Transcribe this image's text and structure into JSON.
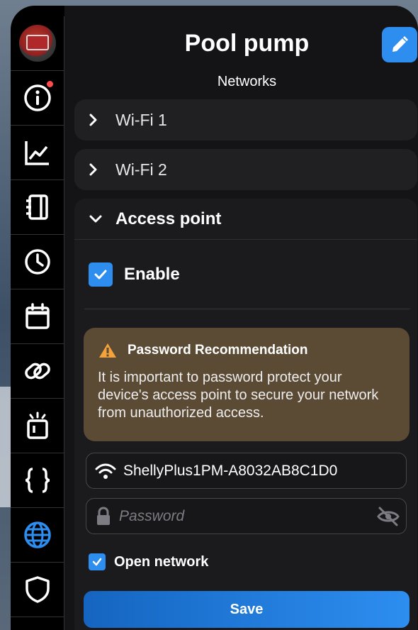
{
  "app": {
    "title": "Pool pump",
    "subtitle": "Networks",
    "accent_color": "#2d8ef0"
  },
  "sidebar": {
    "items": [
      {
        "name": "device-avatar",
        "icon": "device-avatar"
      },
      {
        "name": "info",
        "icon": "info-icon",
        "notification": true
      },
      {
        "name": "charts",
        "icon": "chart-icon"
      },
      {
        "name": "components",
        "icon": "components-icon"
      },
      {
        "name": "schedules",
        "icon": "clock-icon"
      },
      {
        "name": "calendar",
        "icon": "calendar-icon"
      },
      {
        "name": "links",
        "icon": "link-icon"
      },
      {
        "name": "actions",
        "icon": "action-icon"
      },
      {
        "name": "scripts",
        "icon": "code-icon"
      },
      {
        "name": "networks",
        "icon": "globe-icon",
        "active": true
      },
      {
        "name": "security",
        "icon": "shield-icon"
      }
    ]
  },
  "networks": {
    "sections": [
      {
        "label": "Wi-Fi 1",
        "expanded": false
      },
      {
        "label": "Wi-Fi 2",
        "expanded": false
      }
    ],
    "access_point": {
      "label": "Access point",
      "expanded": true,
      "enable_label": "Enable",
      "enable_checked": true,
      "warning": {
        "title": "Password Recommendation",
        "text": "It is important to password protect your device's access point to secure your network from unauthorized access."
      },
      "ssid": "ShellyPlus1PM-A8032AB8C1D0",
      "password_placeholder": "Password",
      "open_network_label": "Open network",
      "open_network_checked": true,
      "save_label": "Save"
    }
  }
}
